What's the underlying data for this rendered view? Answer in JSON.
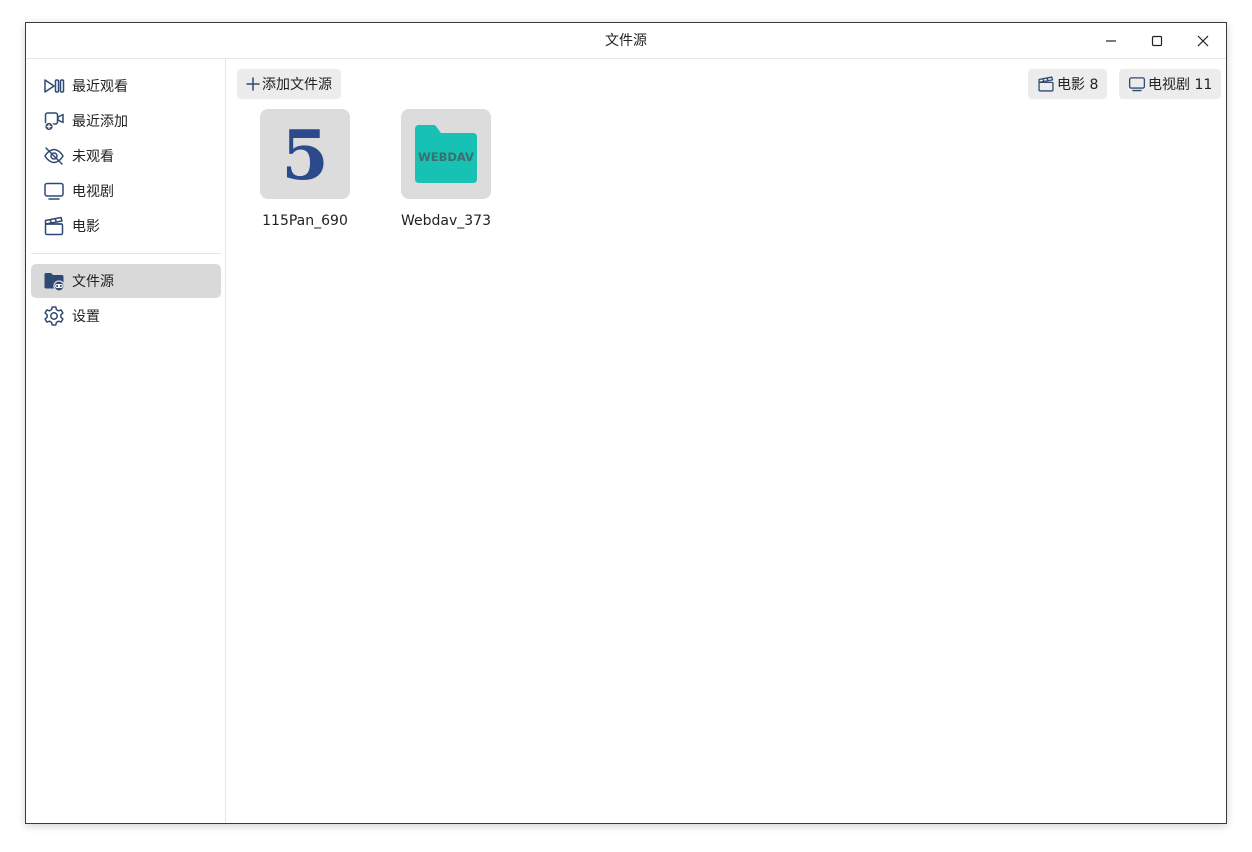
{
  "window": {
    "title": "文件源"
  },
  "sidebar": {
    "items": [
      {
        "label": "最近观看",
        "icon": "recent-play-icon"
      },
      {
        "label": "最近添加",
        "icon": "recent-add-icon"
      },
      {
        "label": "未观看",
        "icon": "eye-off-icon"
      },
      {
        "label": "电视剧",
        "icon": "tv-icon"
      },
      {
        "label": "电影",
        "icon": "clapperboard-icon"
      },
      {
        "label": "文件源",
        "icon": "folder-link-icon",
        "active": true
      },
      {
        "label": "设置",
        "icon": "gear-icon"
      }
    ]
  },
  "toolbar": {
    "add_source_label": "添加文件源",
    "movies_count_label": "电影 8",
    "tv_count_label": "电视剧 11"
  },
  "sources": [
    {
      "name": "115Pan_690",
      "icon": "115-logo-icon",
      "logo_text": "5",
      "logo_color": "#2a4a8c"
    },
    {
      "name": "Webdav_373",
      "icon": "webdav-folder-icon",
      "logo_text": "WEBDAV",
      "logo_color": "#17c1b3"
    }
  ],
  "colors": {
    "icon": "#2f4a72",
    "active_bg": "#d9d9d9",
    "button_bg": "#ececec"
  }
}
